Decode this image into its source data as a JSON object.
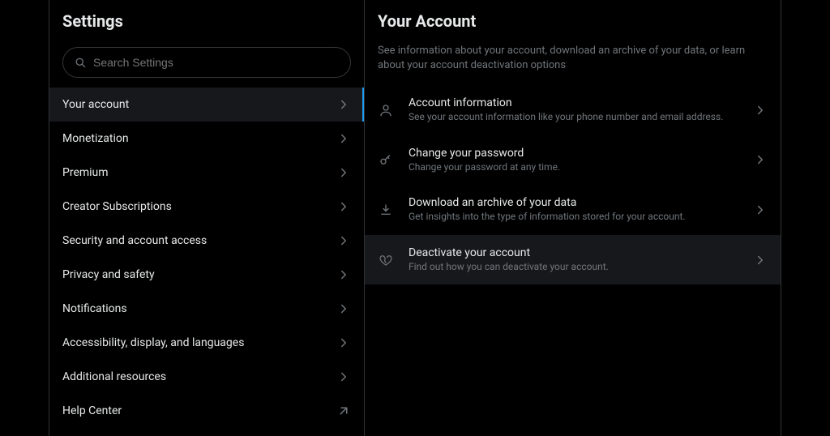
{
  "settings": {
    "title": "Settings",
    "search_placeholder": "Search Settings",
    "nav": [
      {
        "label": "Your account",
        "type": "internal",
        "active": true
      },
      {
        "label": "Monetization",
        "type": "internal",
        "active": false
      },
      {
        "label": "Premium",
        "type": "internal",
        "active": false
      },
      {
        "label": "Creator Subscriptions",
        "type": "internal",
        "active": false
      },
      {
        "label": "Security and account access",
        "type": "internal",
        "active": false
      },
      {
        "label": "Privacy and safety",
        "type": "internal",
        "active": false
      },
      {
        "label": "Notifications",
        "type": "internal",
        "active": false
      },
      {
        "label": "Accessibility, display, and languages",
        "type": "internal",
        "active": false
      },
      {
        "label": "Additional resources",
        "type": "internal",
        "active": false
      },
      {
        "label": "Help Center",
        "type": "external",
        "active": false
      }
    ]
  },
  "detail": {
    "title": "Your Account",
    "subtitle": "See information about your account, download an archive of your data, or learn about your account deactivation options",
    "options": [
      {
        "icon": "user",
        "title": "Account information",
        "desc": "See your account information like your phone number and email address.",
        "highlighted": false
      },
      {
        "icon": "key",
        "title": "Change your password",
        "desc": "Change your password at any time.",
        "highlighted": false
      },
      {
        "icon": "download",
        "title": "Download an archive of your data",
        "desc": "Get insights into the type of information stored for your account.",
        "highlighted": false
      },
      {
        "icon": "heartbreak",
        "title": "Deactivate your account",
        "desc": "Find out how you can deactivate your account.",
        "highlighted": true
      }
    ]
  }
}
